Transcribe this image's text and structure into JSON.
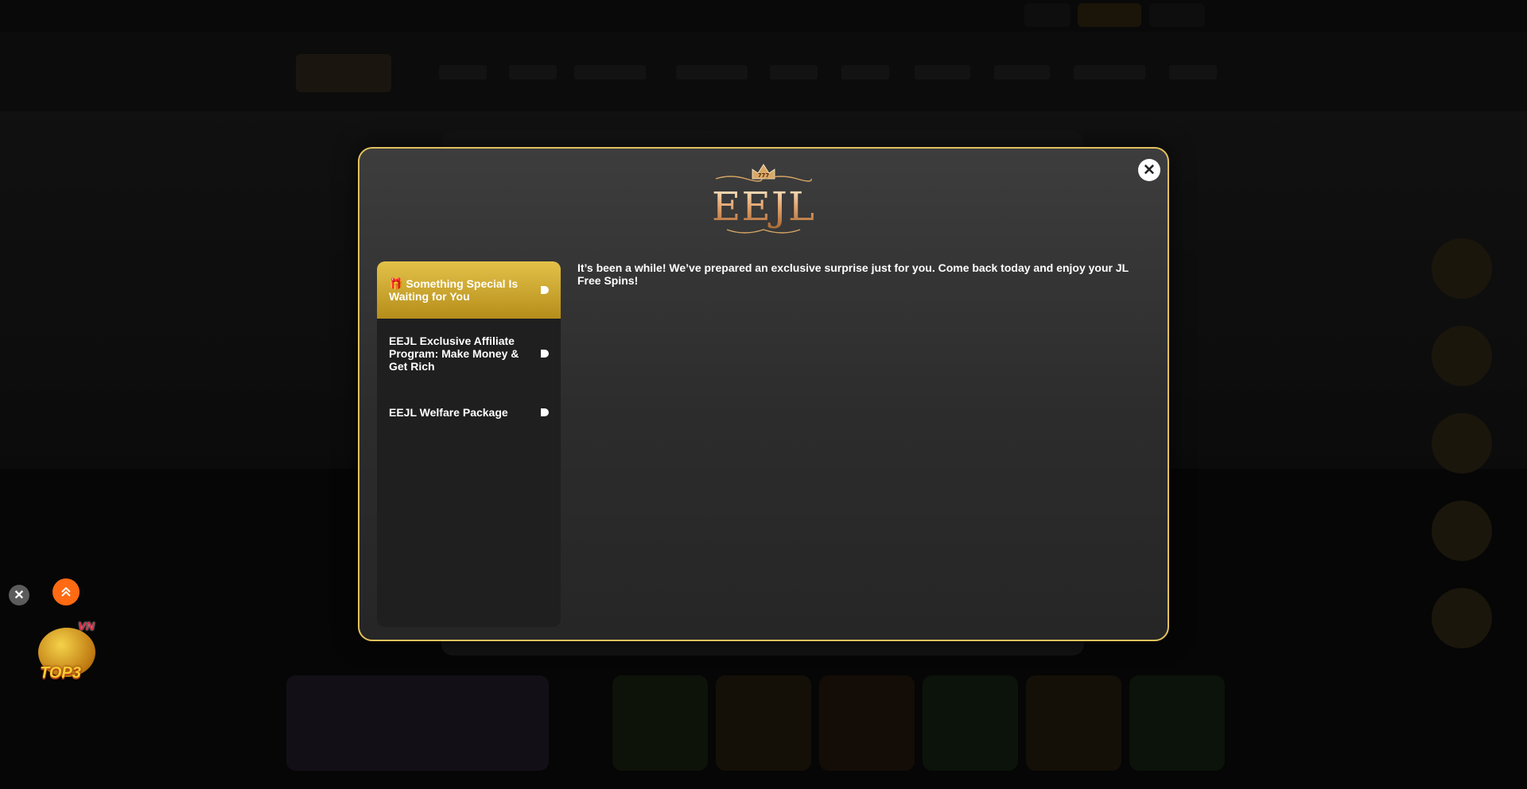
{
  "modal": {
    "logo_text": "EEJL",
    "logo_crown_text": "777",
    "sidebar": {
      "items": [
        {
          "icon": "🎁",
          "label": "Something Special Is Waiting for You",
          "active": true
        },
        {
          "label": "EEJL Exclusive Affiliate Program: Make Money & Get Rich",
          "active": false
        },
        {
          "label": "EEJL Welfare Package",
          "active": false
        }
      ]
    },
    "content": {
      "message": "It’s been a while! We’ve prepared an exclusive surprise just for you. Come back today and enjoy your JL Free Spins!"
    },
    "close_symbol": "✕"
  },
  "floating": {
    "close_symbol": "✕",
    "top3_badge": {
      "label": "TOP3",
      "region": "VN"
    }
  },
  "colors": {
    "accent_gold": "#e2c15e",
    "active_item_top": "#e3c249",
    "active_item_bottom": "#b58d1a",
    "scroll_top": "#ff6a13"
  }
}
